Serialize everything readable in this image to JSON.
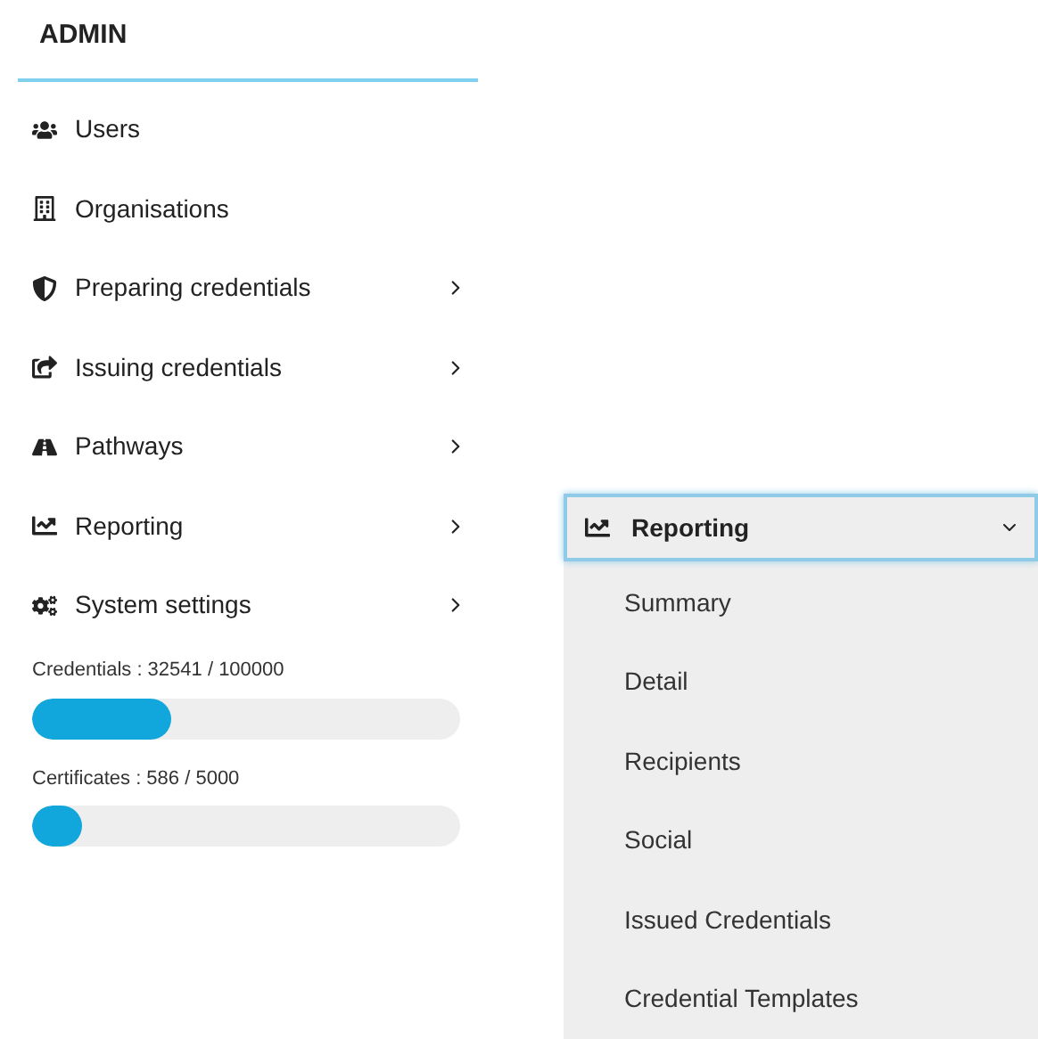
{
  "sidebar": {
    "title": "ADMIN",
    "items": [
      {
        "label": "Users",
        "expandable": false
      },
      {
        "label": "Organisations",
        "expandable": false
      },
      {
        "label": "Preparing credentials",
        "expandable": true
      },
      {
        "label": "Issuing credentials",
        "expandable": true
      },
      {
        "label": "Pathways",
        "expandable": true
      },
      {
        "label": "Reporting",
        "expandable": true
      },
      {
        "label": "System settings",
        "expandable": true
      }
    ],
    "usage": [
      {
        "label": "Credentials : 32541 / 100000",
        "level": 0.325
      },
      {
        "label": "Certificates : 586 / 5000",
        "level": 0.117
      }
    ]
  },
  "submenu": {
    "title": "Reporting",
    "expanded": true,
    "items": [
      "Summary",
      "Detail",
      "Recipients",
      "Social",
      "Issued Credentials",
      "Credential Templates"
    ]
  }
}
